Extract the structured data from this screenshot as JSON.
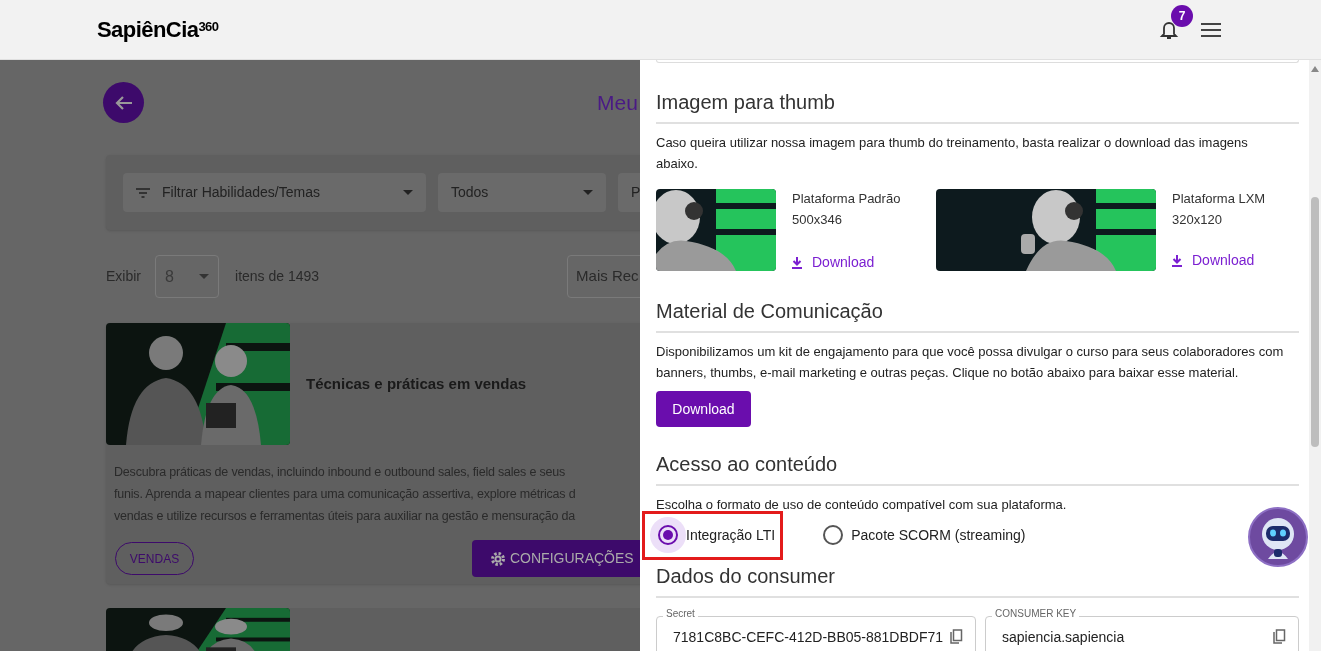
{
  "header": {
    "logo": "SapiênCia$^{360}$",
    "notifications": "7"
  },
  "page": {
    "title": "Meu",
    "filters": [
      "Filtrar Habilidades/Temas",
      "Todos",
      "P"
    ],
    "show_label": "Exibir",
    "page_size": "8",
    "count": "itens de 1493",
    "sort": "Mais Rec",
    "courses": [
      {
        "title": "Técnicas e práticas em vendas",
        "description": [
          "Descubra práticas de vendas, incluindo inbound e outbound sales, field sales e seus",
          "funis. Aprenda a mapear clientes para uma comunicação assertiva, explore métricas d",
          "vendas e utilize recursos e ferramentas úteis para auxiliar na gestão e mensuração da"
        ],
        "tag": "VENDAS",
        "button": "CONFIGURAÇÕES"
      }
    ]
  },
  "drawer": {
    "thumb": {
      "title": "Imagem para thumb",
      "text": "Caso queira utilizar nossa imagem para thumb do treinamento, basta realizar o download das imagens abaixo.",
      "images": [
        {
          "name": "Plataforma Padrão",
          "size": "500x346",
          "link": "Download"
        },
        {
          "name": "Plataforma LXM",
          "size": "320x120",
          "link": "Download"
        }
      ]
    },
    "material": {
      "title": "Material de Comunicação",
      "text": "Disponibilizamos um kit de engajamento para que você possa divulgar o curso para seus colaboradores com banners, thumbs, e-mail marketing e outras peças. Clique no botão abaixo para baixar esse material.",
      "button": "Download"
    },
    "access": {
      "title": "Acesso ao conteúdo",
      "text": "Escolha o formato de uso de conteúdo compatível com sua plataforma.",
      "options": [
        {
          "label": "Integração LTI",
          "selected": true
        },
        {
          "label": "Pacote SCORM (streaming)",
          "selected": false
        }
      ]
    },
    "consumer": {
      "title": "Dados do consumer",
      "fields": [
        {
          "label": "Secret",
          "value": "7181C8BC-CEFC-412D-BB05-881DBDF71"
        },
        {
          "label": "CONSUMER KEY",
          "value": "sapiencia.sapiencia"
        }
      ]
    }
  }
}
